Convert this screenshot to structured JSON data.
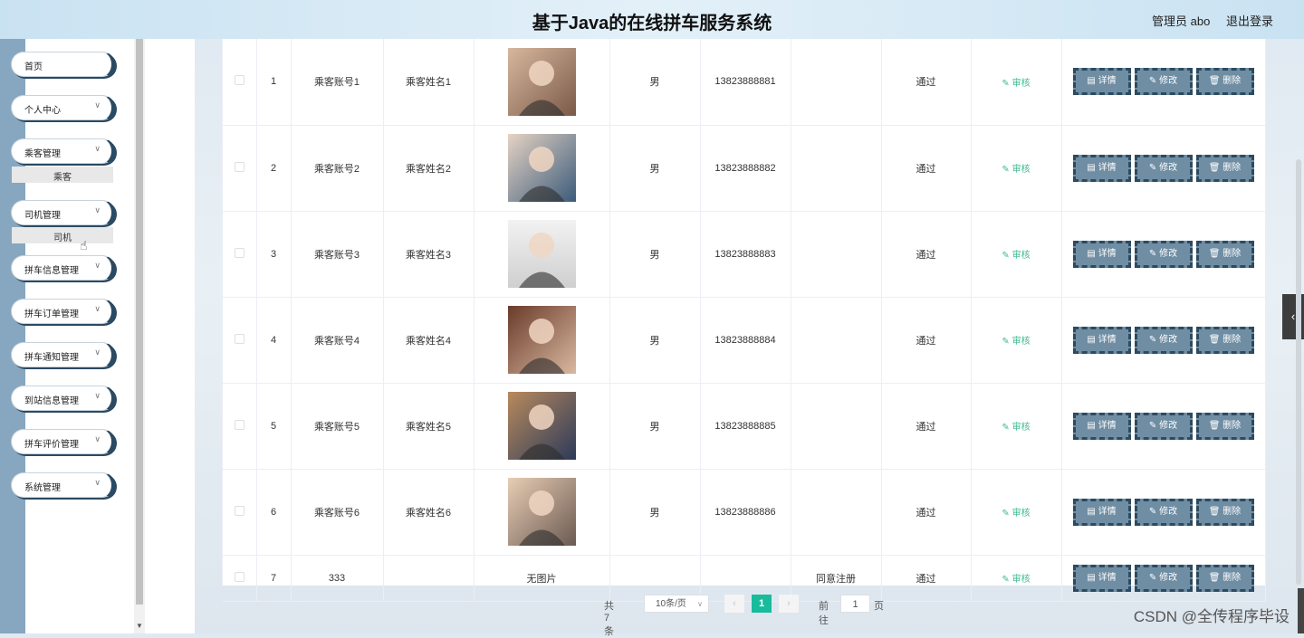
{
  "header": {
    "title": "基于Java的在线拼车服务系统",
    "user": "管理员 abo",
    "logout": "退出登录"
  },
  "sidebar": {
    "items": [
      {
        "label": "首页",
        "chevron": false
      },
      {
        "label": "个人中心",
        "chevron": true
      },
      {
        "label": "乘客管理",
        "chevron": true,
        "sub": "乘客"
      },
      {
        "label": "司机管理",
        "chevron": true,
        "sub": "司机"
      },
      {
        "label": "拼车信息管理",
        "chevron": true
      },
      {
        "label": "拼车订单管理",
        "chevron": true
      },
      {
        "label": "拼车通知管理",
        "chevron": true
      },
      {
        "label": "到站信息管理",
        "chevron": true
      },
      {
        "label": "拼车评价管理",
        "chevron": true
      },
      {
        "label": "系统管理",
        "chevron": true
      }
    ]
  },
  "table": {
    "rows": [
      {
        "no": "1",
        "account": "乘客账号1",
        "name": "乘客姓名1",
        "photo": "photo-1",
        "gender": "男",
        "phone": "13823888881",
        "remark": "",
        "status": "通过"
      },
      {
        "no": "2",
        "account": "乘客账号2",
        "name": "乘客姓名2",
        "photo": "photo-2",
        "gender": "男",
        "phone": "13823888882",
        "remark": "",
        "status": "通过"
      },
      {
        "no": "3",
        "account": "乘客账号3",
        "name": "乘客姓名3",
        "photo": "photo-3",
        "gender": "男",
        "phone": "13823888883",
        "remark": "",
        "status": "通过"
      },
      {
        "no": "4",
        "account": "乘客账号4",
        "name": "乘客姓名4",
        "photo": "photo-4",
        "gender": "男",
        "phone": "13823888884",
        "remark": "",
        "status": "通过"
      },
      {
        "no": "5",
        "account": "乘客账号5",
        "name": "乘客姓名5",
        "photo": "photo-5",
        "gender": "男",
        "phone": "13823888885",
        "remark": "",
        "status": "通过"
      },
      {
        "no": "6",
        "account": "乘客账号6",
        "name": "乘客姓名6",
        "photo": "photo-6",
        "gender": "男",
        "phone": "13823888886",
        "remark": "",
        "status": "通过"
      },
      {
        "no": "7",
        "account": "333",
        "name": "",
        "photo": null,
        "photo_text": "无图片",
        "gender": "",
        "phone": "",
        "remark": "同意注册",
        "status": "通过"
      }
    ],
    "audit_label": "✎ 审核",
    "detail_label": "▤ 详情",
    "edit_label": "✎ 修改",
    "delete_label": "🗑 删除"
  },
  "pagination": {
    "total": "共 7 条",
    "page_size": "10条/页",
    "prev": "‹",
    "current": "1",
    "next": "›",
    "goto_prefix": "前往",
    "goto_value": "1",
    "goto_suffix": "页"
  },
  "watermark": "CSDN @全传程序毕设",
  "colors": {
    "accent": "#18bc9c",
    "action_button": "#6f8da3",
    "sidebar_strip": "#86a7bf"
  }
}
